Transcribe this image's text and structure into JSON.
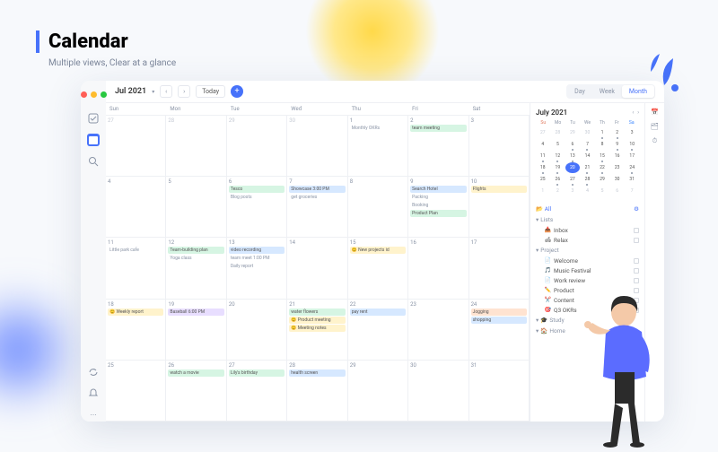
{
  "hero": {
    "title": "Calendar",
    "subtitle": "Multiple views, Clear at a glance"
  },
  "toolbar": {
    "month": "Jul 2021",
    "today": "Today",
    "views": [
      "Day",
      "Week",
      "Month"
    ],
    "active_view": "Month"
  },
  "dow": [
    "Sun",
    "Mon",
    "Tue",
    "Wed",
    "Thu",
    "Fri",
    "Sat"
  ],
  "weeks": [
    [
      {
        "n": "27",
        "out": true,
        "ev": []
      },
      {
        "n": "28",
        "out": true,
        "ev": []
      },
      {
        "n": "29",
        "out": true,
        "ev": []
      },
      {
        "n": "30",
        "out": true,
        "ev": []
      },
      {
        "n": "1",
        "ev": [
          {
            "t": "Monthly OKRs",
            "c": "plain"
          }
        ]
      },
      {
        "n": "2",
        "ev": [
          {
            "t": "team meeting",
            "c": "green"
          }
        ]
      },
      {
        "n": "3",
        "ev": []
      }
    ],
    [
      {
        "n": "4",
        "ev": []
      },
      {
        "n": "5",
        "ev": []
      },
      {
        "n": "6",
        "ev": [
          {
            "t": "Tesco",
            "c": "green"
          },
          {
            "t": "Blog posts",
            "c": "plain"
          }
        ]
      },
      {
        "n": "7",
        "ev": [
          {
            "t": "Showcase 3:00 PM",
            "c": "blue"
          },
          {
            "t": "get groceries",
            "c": "plain"
          }
        ]
      },
      {
        "n": "8",
        "ev": []
      },
      {
        "n": "9",
        "ev": [
          {
            "t": "Search Hotel",
            "c": "blue"
          },
          {
            "t": "Packing",
            "c": "plain"
          },
          {
            "t": "Booking",
            "c": "plain"
          },
          {
            "t": "Product Plan",
            "c": "green"
          }
        ]
      },
      {
        "n": "10",
        "ev": [
          {
            "t": "Flights",
            "c": "yellow"
          }
        ]
      }
    ],
    [
      {
        "n": "11",
        "ev": [
          {
            "t": "Little park cafe",
            "c": "plain"
          }
        ]
      },
      {
        "n": "12",
        "ev": [
          {
            "t": "Team-building plan",
            "c": "green"
          },
          {
            "t": "Yoga class",
            "c": "plain"
          }
        ]
      },
      {
        "n": "13",
        "ev": [
          {
            "t": "video recording",
            "c": "blue"
          },
          {
            "t": "team meet 1:00 PM",
            "c": "plain"
          },
          {
            "t": "Daily report",
            "c": "plain"
          }
        ]
      },
      {
        "n": "14",
        "ev": []
      },
      {
        "n": "15",
        "ev": [
          {
            "t": "😊 New projects id",
            "c": "yellow"
          }
        ]
      },
      {
        "n": "16",
        "ev": []
      },
      {
        "n": "17",
        "ev": []
      }
    ],
    [
      {
        "n": "18",
        "ev": [
          {
            "t": "😊 Weekly report",
            "c": "yellow"
          }
        ]
      },
      {
        "n": "19",
        "ev": [
          {
            "t": "Baseball 6:00 PM",
            "c": "purple"
          }
        ]
      },
      {
        "n": "20",
        "ev": []
      },
      {
        "n": "21",
        "ev": [
          {
            "t": "water flowers",
            "c": "green"
          },
          {
            "t": "😊 Product meeting",
            "c": "yellow"
          },
          {
            "t": "😊 Meeting notes",
            "c": "yellow"
          }
        ]
      },
      {
        "n": "22",
        "ev": [
          {
            "t": "pay rent",
            "c": "blue"
          }
        ]
      },
      {
        "n": "23",
        "ev": []
      },
      {
        "n": "24",
        "ev": [
          {
            "t": "Jogging",
            "c": "orange"
          },
          {
            "t": "shopping",
            "c": "blue"
          }
        ]
      }
    ],
    [
      {
        "n": "25",
        "ev": []
      },
      {
        "n": "26",
        "ev": [
          {
            "t": "watch a movie",
            "c": "green"
          }
        ]
      },
      {
        "n": "27",
        "ev": [
          {
            "t": "Lily's birthday",
            "c": "green"
          }
        ]
      },
      {
        "n": "28",
        "ev": [
          {
            "t": "health screen",
            "c": "blue"
          }
        ]
      },
      {
        "n": "29",
        "ev": []
      },
      {
        "n": "30",
        "ev": []
      },
      {
        "n": "31",
        "ev": []
      }
    ]
  ],
  "mini": {
    "title": "July 2021",
    "dow": [
      "Su",
      "Mo",
      "Tu",
      "We",
      "Th",
      "Fr",
      "Sa"
    ],
    "cells": [
      {
        "n": "27",
        "out": true
      },
      {
        "n": "28",
        "out": true
      },
      {
        "n": "29",
        "out": true
      },
      {
        "n": "30",
        "out": true
      },
      {
        "n": "1",
        "dot": true
      },
      {
        "n": "2",
        "dot": true
      },
      {
        "n": "3"
      },
      {
        "n": "4"
      },
      {
        "n": "5"
      },
      {
        "n": "6",
        "dot": true
      },
      {
        "n": "7",
        "dot": true
      },
      {
        "n": "8"
      },
      {
        "n": "9",
        "dot": true
      },
      {
        "n": "10",
        "dot": true
      },
      {
        "n": "11",
        "dot": true
      },
      {
        "n": "12",
        "dot": true
      },
      {
        "n": "13",
        "dot": true
      },
      {
        "n": "14"
      },
      {
        "n": "15",
        "dot": true
      },
      {
        "n": "16"
      },
      {
        "n": "17"
      },
      {
        "n": "18",
        "dot": true
      },
      {
        "n": "19",
        "dot": true
      },
      {
        "n": "20",
        "today": true
      },
      {
        "n": "21",
        "dot": true
      },
      {
        "n": "22",
        "dot": true
      },
      {
        "n": "23"
      },
      {
        "n": "24",
        "dot": true
      },
      {
        "n": "25"
      },
      {
        "n": "26",
        "dot": true
      },
      {
        "n": "27",
        "dot": true
      },
      {
        "n": "28",
        "dot": true
      },
      {
        "n": "29"
      },
      {
        "n": "30"
      },
      {
        "n": "31"
      },
      {
        "n": "1",
        "out": true
      },
      {
        "n": "2",
        "out": true
      },
      {
        "n": "3",
        "out": true
      },
      {
        "n": "4",
        "out": true
      },
      {
        "n": "5",
        "out": true
      },
      {
        "n": "6",
        "out": true
      },
      {
        "n": "7",
        "out": true
      }
    ]
  },
  "lists": {
    "all": "All",
    "groups": [
      {
        "name": "Lists",
        "items": [
          {
            "icon": "📥",
            "label": "Inbox"
          },
          {
            "icon": "🛋",
            "label": "Relax"
          }
        ]
      },
      {
        "name": "Project",
        "items": [
          {
            "icon": "📄",
            "label": "Welcome"
          },
          {
            "icon": "🎵",
            "label": "Music Festival"
          },
          {
            "icon": "📄",
            "label": "Work review"
          },
          {
            "icon": "✏️",
            "label": "Product"
          },
          {
            "icon": "✂️",
            "label": "Content"
          },
          {
            "icon": "🎯",
            "label": "Q3 OKRs"
          }
        ]
      },
      {
        "name": "Study",
        "items": [],
        "icon": "🎓"
      },
      {
        "name": "Home",
        "items": [],
        "icon": "🏠"
      }
    ]
  }
}
